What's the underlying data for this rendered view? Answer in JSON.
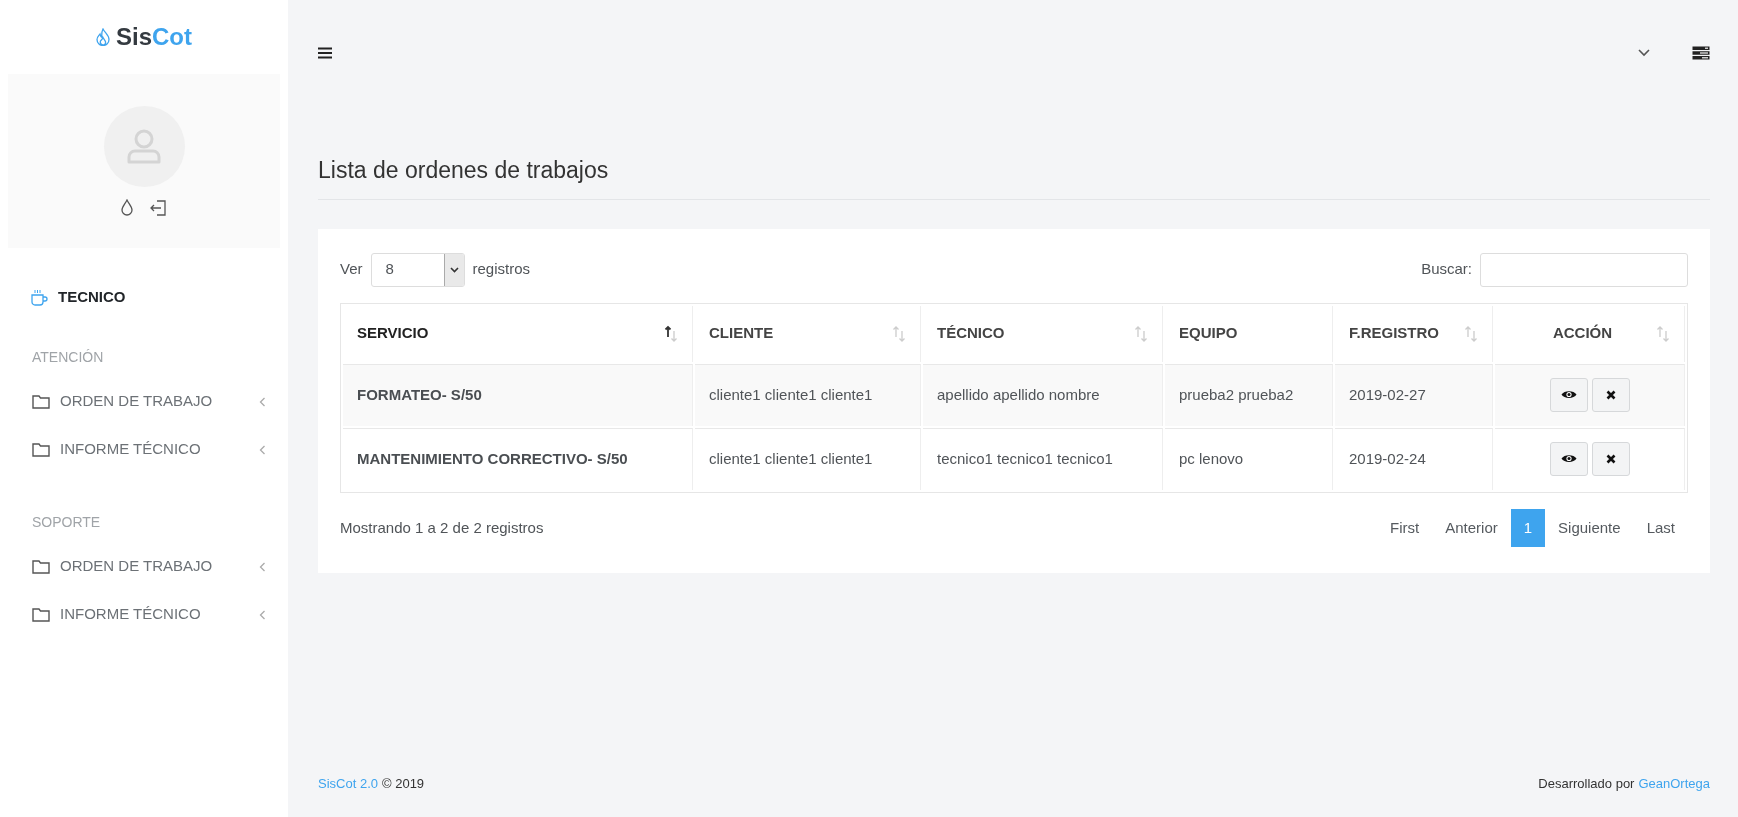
{
  "logo": {
    "prefix": "Sis",
    "suffix": "Cot"
  },
  "sidebar": {
    "role": "TECNICO",
    "sections": [
      {
        "header": "ATENCIÓN",
        "items": [
          {
            "label": "ORDEN DE TRABAJO",
            "expanded": false
          },
          {
            "label": "INFORME TÉCNICO",
            "expanded": false
          }
        ]
      },
      {
        "header": "SOPORTE",
        "items": [
          {
            "label": "ORDEN DE TRABAJO",
            "expanded": false
          },
          {
            "label": "INFORME TÉCNICO",
            "expanded": false
          }
        ]
      }
    ]
  },
  "page_title": "Lista de ordenes de trabajos",
  "length_control": {
    "prefix": "Ver",
    "value": "8",
    "suffix": "registros"
  },
  "search": {
    "label": "Buscar:"
  },
  "table": {
    "columns": [
      {
        "label": "SERVICIO",
        "sortable": true,
        "sorted": true
      },
      {
        "label": "CLIENTE",
        "sortable": true,
        "sorted": false
      },
      {
        "label": "TÉCNICO",
        "sortable": true,
        "sorted": false
      },
      {
        "label": "EQUIPO",
        "sortable": false,
        "sorted": false
      },
      {
        "label": "F.REGISTRO",
        "sortable": true,
        "sorted": false
      },
      {
        "label": "ACCIÓN",
        "sortable": true,
        "sorted": false
      }
    ],
    "rows": [
      {
        "servicio": "FORMATEO- S/50",
        "cliente": "cliente1 cliente1 cliente1",
        "tecnico": "apellido apellido nombre",
        "equipo": "prueba2 prueba2",
        "fecha": "2019-02-27"
      },
      {
        "servicio": "MANTENIMIENTO CORRECTIVO- S/50",
        "cliente": "cliente1 cliente1 cliente1",
        "tecnico": "tecnico1 tecnico1 tecnico1",
        "equipo": "pc lenovo",
        "fecha": "2019-02-24"
      }
    ]
  },
  "info": "Mostrando 1 a 2 de 2 registros",
  "pagination": [
    {
      "label": "First",
      "selected": false
    },
    {
      "label": "Anterior",
      "selected": false
    },
    {
      "label": "1",
      "selected": true
    },
    {
      "label": "Siguiente",
      "selected": false
    },
    {
      "label": "Last",
      "selected": false
    }
  ],
  "footer": {
    "product": "SisCot 2.0",
    "copyright": "© 2019",
    "credit": "Desarrollado por",
    "author": "GeanOrtega"
  }
}
